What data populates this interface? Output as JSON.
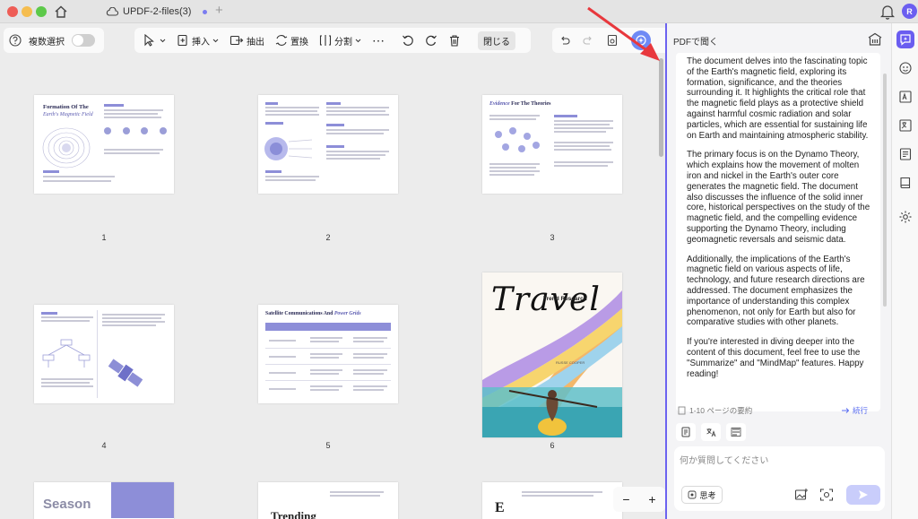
{
  "titlebar": {
    "tab_title": "UPDF-2-files(3)",
    "avatar_initial": "R"
  },
  "toolbar": {
    "multi_select_label": "複数選択",
    "insert_label": "挿入",
    "extract_label": "抽出",
    "replace_label": "置換",
    "split_label": "分割",
    "close_label": "閉じる"
  },
  "pages": [
    {
      "number": "1",
      "title_a": "Formation Of The",
      "title_b": "Earth's Magnetic Field"
    },
    {
      "number": "2"
    },
    {
      "number": "3",
      "title_a": "Evidence",
      "title_b": "For The Theories"
    },
    {
      "number": "4"
    },
    {
      "number": "5",
      "title_a": "Satellite Communications And",
      "title_b": "Power Grids"
    },
    {
      "number": "6",
      "title_a": "Travel",
      "title_b": "Trend Research",
      "author": "RUSSE COOPER"
    },
    {
      "number": "",
      "title_a": "Season"
    },
    {
      "number": "",
      "title_a": "Trending"
    },
    {
      "number": "",
      "title_a": "E"
    }
  ],
  "zoom": {
    "minus": "−",
    "plus": "+"
  },
  "panel": {
    "header": "PDFで聞く",
    "paragraphs": [
      "The document delves into the fascinating topic of the Earth's magnetic field, exploring its formation, significance, and the theories surrounding it. It highlights the critical role that the magnetic field plays as a protective shield against harmful cosmic radiation and solar particles, which are essential for sustaining life on Earth and maintaining atmospheric stability.",
      "The primary focus is on the Dynamo Theory, which explains how the movement of molten iron and nickel in the Earth's outer core generates the magnetic field. The document also discusses the influence of the solid inner core, historical perspectives on the study of the magnetic field, and the compelling evidence supporting the Dynamo Theory, including geomagnetic reversals and seismic data.",
      "Additionally, the implications of the Earth's magnetic field on various aspects of life, technology, and future research directions are addressed. The document emphasizes the importance of understanding this complex phenomenon, not only for Earth but also for comparative studies with other planets.",
      "If you're interested in diving deeper into the content of this document, feel free to use the \"Summarize\" and \"MindMap\" features. Happy reading!"
    ],
    "summary_label": "1-10 ページの要約",
    "continue_label": "続行",
    "input_placeholder": "何か質問してください",
    "think_label": "思考"
  },
  "colors": {
    "accent": "#6a5df0",
    "ai_button": "#6e8af5",
    "arrow": "#e8383d"
  }
}
